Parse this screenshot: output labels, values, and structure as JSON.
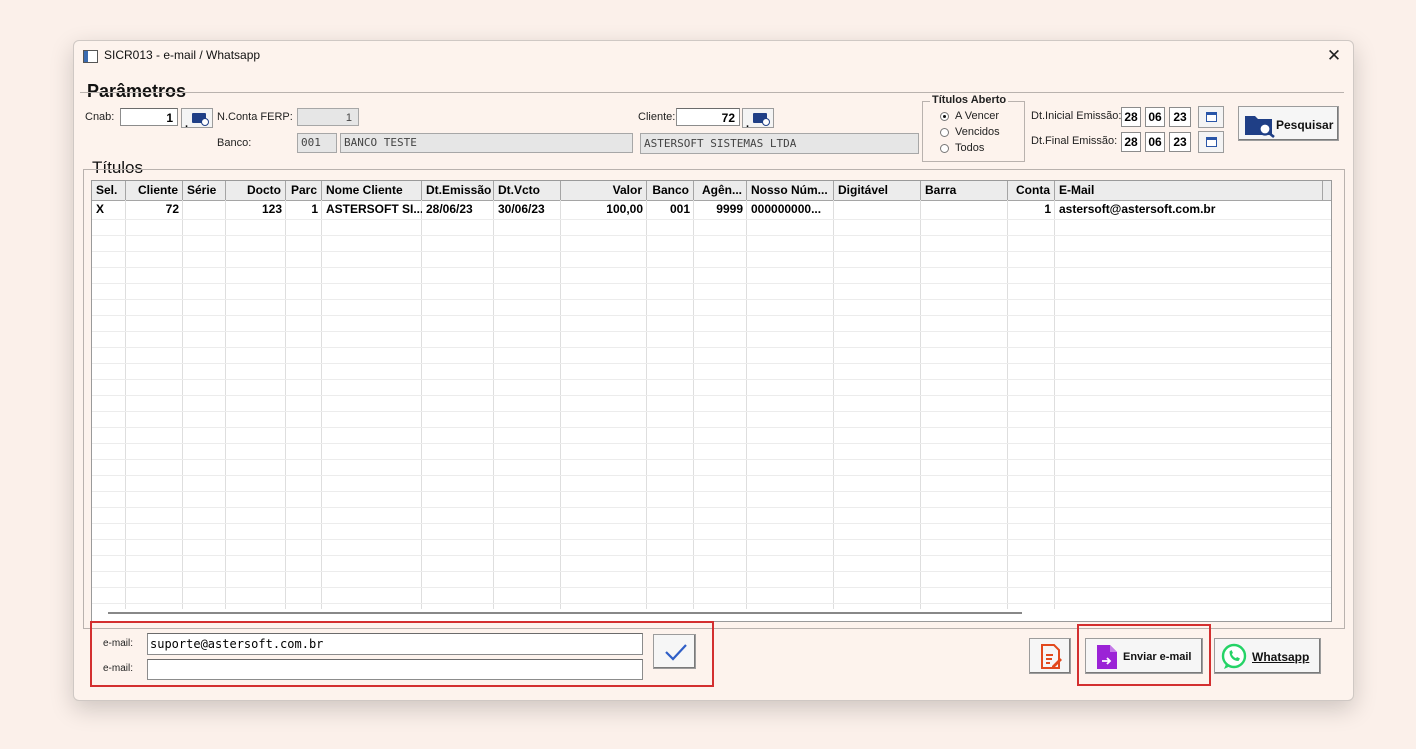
{
  "window": {
    "title": "SICR013 - e-mail / Whatsapp"
  },
  "parametros": {
    "title": "Parâmetros",
    "cnab_label": "Cnab:",
    "cnab_value": "1",
    "nconta_label": "N.Conta FERP:",
    "nconta_value": "1",
    "banco_label": "Banco:",
    "banco_code": "001",
    "banco_name": "BANCO TESTE",
    "cliente_label": "Cliente:",
    "cliente_value": "72",
    "cliente_name": "ASTERSOFT SISTEMAS LTDA",
    "titulos_aberto": {
      "title": "Títulos Aberto",
      "options": [
        "A Vencer",
        "Vencidos",
        "Todos"
      ],
      "selected": "A Vencer"
    },
    "dt_inicial_label": "Dt.Inicial Emissão:",
    "dt_inicial": {
      "d": "28",
      "m": "06",
      "y": "23"
    },
    "dt_final_label": "Dt.Final Emissão:",
    "dt_final": {
      "d": "28",
      "m": "06",
      "y": "23"
    },
    "pesquisar_label": "Pesquisar",
    "search_button_dot": "."
  },
  "titulos": {
    "title": "Títulos",
    "columns": [
      "Sel.",
      "Cliente",
      "Série",
      "Docto",
      "Parc",
      "Nome Cliente",
      "Dt.Emissão",
      "Dt.Vcto",
      "Valor",
      "Banco",
      "Agên...",
      "Nosso Núm...",
      "Digitável",
      "Barra",
      "Conta",
      "E-Mail"
    ],
    "rows": [
      [
        "X",
        "72",
        "",
        "123",
        "1",
        "ASTERSOFT SI...",
        "28/06/23",
        "30/06/23",
        "100,00",
        "001",
        "9999",
        "000000000...",
        "",
        "",
        "1",
        "astersoft@astersoft.com.br"
      ]
    ]
  },
  "email": {
    "label1": "e-mail:",
    "value1": "suporte@astersoft.com.br",
    "label2": "e-mail:",
    "value2": ""
  },
  "actions": {
    "enviar_label": "Enviar e-mail",
    "whatsapp_label": "Whatsapp"
  },
  "colors": {
    "highlight": "#d32f2f",
    "whatsapp": "#25d366",
    "email_icon": "#9b23d6",
    "report_icon": "#e2491d"
  }
}
